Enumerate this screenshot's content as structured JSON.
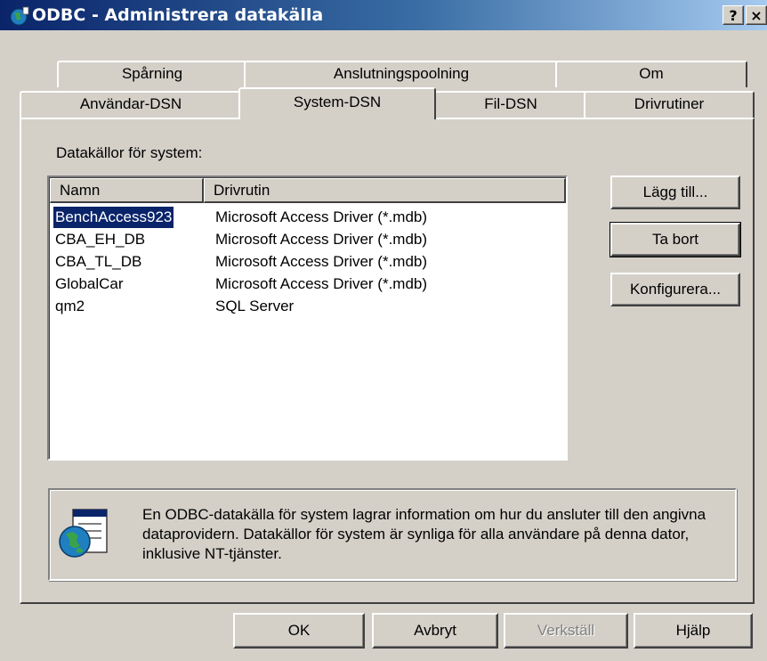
{
  "window": {
    "title": "ODBC - Administrera datakälla",
    "help_button": "?",
    "close_button": "×"
  },
  "tabs": {
    "row_back": [
      "Spårning",
      "Anslutningspoolning",
      "Om"
    ],
    "row_front": [
      "Användar-DSN",
      "System-DSN",
      "Fil-DSN",
      "Drivrutiner"
    ],
    "selected": "System-DSN"
  },
  "panel": {
    "list_label": "Datakällor för system:",
    "columns": [
      "Namn",
      "Drivrutin"
    ],
    "rows": [
      {
        "name": "BenchAccess923",
        "driver": "Microsoft Access Driver (*.mdb)",
        "selected": true
      },
      {
        "name": "CBA_EH_DB",
        "driver": "Microsoft Access Driver (*.mdb)",
        "selected": false
      },
      {
        "name": "CBA_TL_DB",
        "driver": "Microsoft Access Driver (*.mdb)",
        "selected": false
      },
      {
        "name": "GlobalCar",
        "driver": "Microsoft Access Driver (*.mdb)",
        "selected": false
      },
      {
        "name": "qm2",
        "driver": "SQL Server",
        "selected": false
      }
    ],
    "side_buttons": {
      "add": "Lägg till...",
      "remove": "Ta bort",
      "configure": "Konfigurera..."
    },
    "info_text": "En ODBC-datakälla för system lagrar information om hur du ansluter till den angivna dataprovidern. Datakällor för system är synliga för alla användare på denna dator, inklusive NT-tjänster."
  },
  "footer_buttons": {
    "ok": "OK",
    "cancel": "Avbryt",
    "apply": "Verkställ",
    "help": "Hjälp"
  },
  "colors": {
    "face": "#d4d0c8",
    "titlebar_start": "#0a246a",
    "titlebar_end": "#a6caf0",
    "selection": "#0a246a"
  }
}
